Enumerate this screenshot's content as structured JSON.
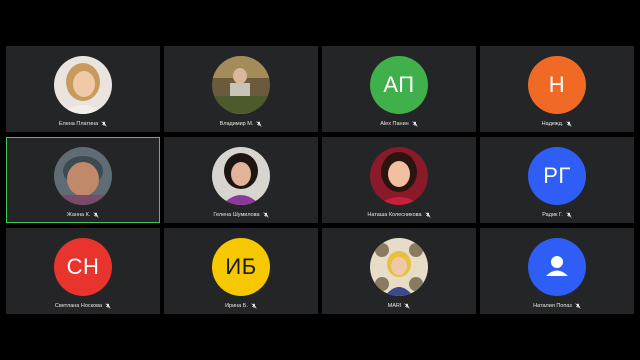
{
  "participants": [
    {
      "name": "Елена Платина",
      "initials": "",
      "avatar": "photo-woman-blonde",
      "color": "",
      "muted": true
    },
    {
      "name": "Владимир М.",
      "initials": "",
      "avatar": "photo-man-garden",
      "color": "",
      "muted": true
    },
    {
      "name": "Alex Панин",
      "initials": "АП",
      "avatar": "initials",
      "color": "#3fb04a",
      "muted": true
    },
    {
      "name": "Надежд.",
      "initials": "Н",
      "avatar": "initials",
      "color": "#f06a26",
      "muted": true
    },
    {
      "name": "Жанна К.",
      "initials": "",
      "avatar": "photo-woman-webcam",
      "color": "",
      "muted": true,
      "active": true
    },
    {
      "name": "Гелена Шумилова",
      "initials": "",
      "avatar": "photo-woman-dark-hair",
      "color": "",
      "muted": true
    },
    {
      "name": "Наташа Колесникова",
      "initials": "",
      "avatar": "photo-woman-portrait",
      "color": "",
      "muted": true
    },
    {
      "name": "Радик Г.",
      "initials": "РГ",
      "avatar": "initials",
      "color": "#2e5ef5",
      "muted": true
    },
    {
      "name": "Светлана Носкова",
      "initials": "СН",
      "avatar": "initials",
      "color": "#e8342c",
      "muted": true
    },
    {
      "name": "Ирина Б.",
      "initials": "ИБ",
      "avatar": "initials",
      "color": "#f5c800",
      "muted": true
    },
    {
      "name": "MARI",
      "initials": "",
      "avatar": "photo-woman-collage",
      "color": "",
      "muted": true
    },
    {
      "name": "Наталия Попаз",
      "initials": "",
      "avatar": "user-icon",
      "color": "#2e5ef5",
      "muted": true
    }
  ],
  "colors": {
    "active_border": "#3ec85a",
    "tile_bg": "#242526",
    "page_bg": "#000000"
  }
}
